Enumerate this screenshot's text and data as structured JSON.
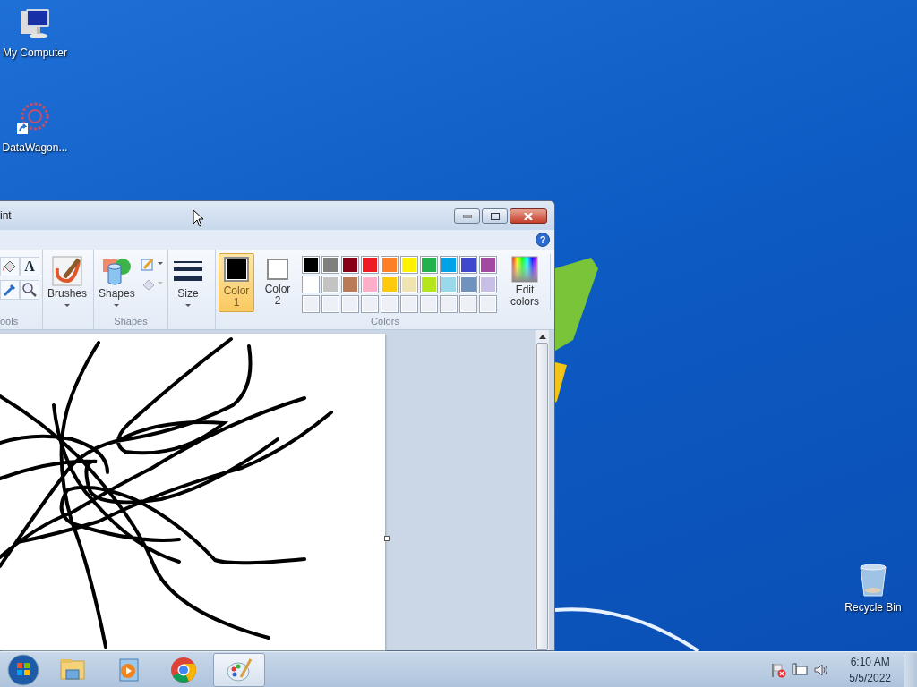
{
  "desktop_icons": [
    {
      "label": "My Computer",
      "kind": "computer"
    },
    {
      "label": "DataWagon...",
      "kind": "shortcut"
    },
    {
      "label": "Recycle Bin",
      "kind": "bin"
    }
  ],
  "window": {
    "title": "int",
    "help": "?",
    "ribbon": {
      "tools_group_label": "ools",
      "text_tool": "A",
      "brushes": "Brushes",
      "shapes": "Shapes",
      "shapes_group_label": "Shapes",
      "size": "Size",
      "color_slots": [
        {
          "label": "Color",
          "number": "1",
          "color": "#000000",
          "selected": true
        },
        {
          "label": "Color",
          "number": "2",
          "color": "#ffffff",
          "selected": false
        }
      ],
      "palette": [
        {
          "color": "#000000"
        },
        {
          "color": "#7f7f7f"
        },
        {
          "color": "#880015"
        },
        {
          "color": "#ed1c24"
        },
        {
          "color": "#ff7f27"
        },
        {
          "color": "#fff200"
        },
        {
          "color": "#22b14c"
        },
        {
          "color": "#00a2e8"
        },
        {
          "color": "#3f48cc"
        },
        {
          "color": "#a349a4"
        },
        {
          "color": "#ffffff"
        },
        {
          "color": "#c3c3c3"
        },
        {
          "color": "#b97a57"
        },
        {
          "color": "#ffaec9"
        },
        {
          "color": "#ffc90e"
        },
        {
          "color": "#efe4b0"
        },
        {
          "color": "#b5e61d"
        },
        {
          "color": "#99d9ea"
        },
        {
          "color": "#7092be"
        },
        {
          "color": "#c8bfe7"
        }
      ],
      "colors_group_label": "Colors",
      "edit_colors": "Edit colors"
    }
  },
  "taskbar": {
    "items": [
      {
        "kind": "explorer",
        "selected": false
      },
      {
        "kind": "media",
        "selected": false
      },
      {
        "kind": "chrome",
        "selected": false
      },
      {
        "kind": "paint",
        "selected": true
      }
    ],
    "time": "6:10 AM",
    "date": "5/5/2022"
  }
}
